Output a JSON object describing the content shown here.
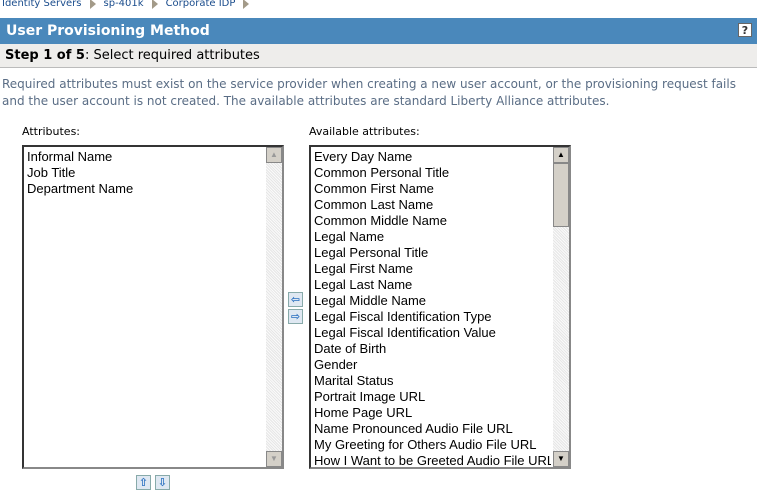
{
  "breadcrumb": [
    "Identity Servers",
    "sp-401k",
    "Corporate IDP"
  ],
  "header": {
    "title": "User Provisioning Method",
    "help": "?"
  },
  "step": {
    "label": "Step 1 of 5",
    "text": ": Select required attributes"
  },
  "description": "Required attributes must exist on the service provider when creating a new user account, or the provisioning request fails and the user account is not created. The available attributes are standard Liberty Alliance attributes.",
  "left": {
    "label": "Attributes:",
    "items": [
      "Informal Name",
      "Job Title",
      "Department Name"
    ]
  },
  "right": {
    "label": "Available attributes:",
    "items": [
      "Every Day Name",
      "Common Personal Title",
      "Common First Name",
      "Common Last Name",
      "Common Middle Name",
      "Legal Name",
      "Legal Personal Title",
      "Legal First Name",
      "Legal Last Name",
      "Legal Middle Name",
      "Legal Fiscal Identification Type",
      "Legal Fiscal Identification Value",
      "Date of Birth",
      "Gender",
      "Marital Status",
      "Portrait Image URL",
      "Home Page URL",
      "Name Pronounced Audio File URL",
      "My Greeting for Others Audio File URL",
      "How I Want to be Greeted Audio File URL"
    ]
  }
}
